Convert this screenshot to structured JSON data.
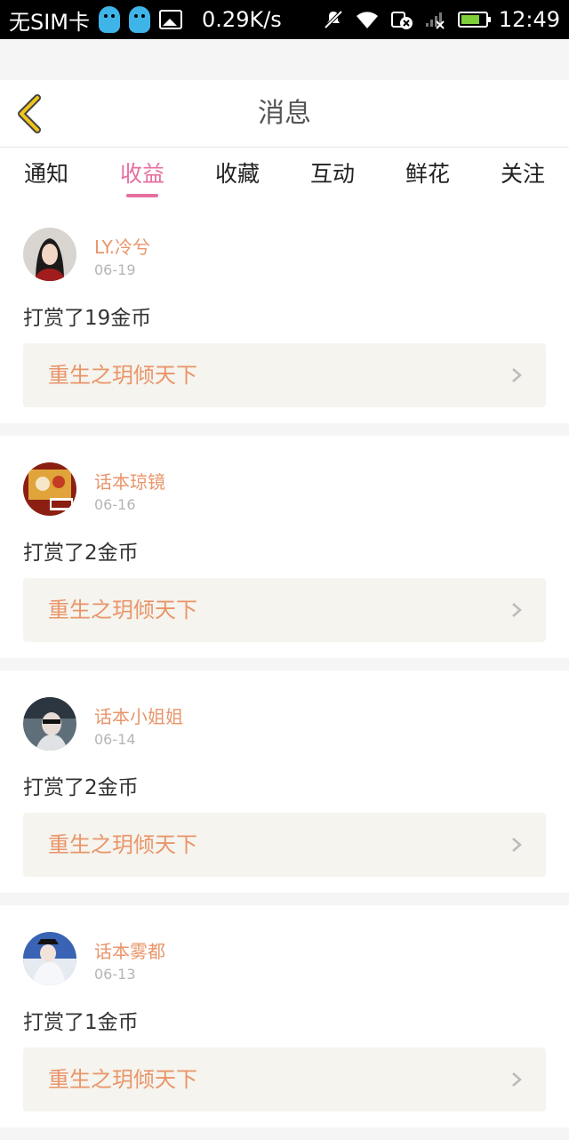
{
  "status_bar": {
    "carrier": "无SIM卡",
    "speed": "0.29K/s",
    "time": "12:49",
    "icons": [
      "qq-icon",
      "qq-icon",
      "gallery-icon",
      "mute-icon",
      "wifi-icon",
      "sim-icon",
      "signal-icon",
      "battery-icon"
    ]
  },
  "header": {
    "title": "消息",
    "back_icon": "back-chevron-icon"
  },
  "tabs": [
    {
      "label": "通知",
      "active": false
    },
    {
      "label": "收益",
      "active": true
    },
    {
      "label": "收藏",
      "active": false
    },
    {
      "label": "互动",
      "active": false
    },
    {
      "label": "鲜花",
      "active": false
    },
    {
      "label": "关注",
      "active": false
    }
  ],
  "messages": [
    {
      "user": "LY.冷兮",
      "date": "06-19",
      "action": "打赏了19金币",
      "book": "重生之玥倾天下"
    },
    {
      "user": "话本琼镜",
      "date": "06-16",
      "action": "打赏了2金币",
      "book": "重生之玥倾天下"
    },
    {
      "user": "话本小姐姐",
      "date": "06-14",
      "action": "打赏了2金币",
      "book": "重生之玥倾天下"
    },
    {
      "user": "话本雾都",
      "date": "06-13",
      "action": "打赏了1金币",
      "book": "重生之玥倾天下"
    }
  ],
  "colors": {
    "accent_pink": "#e66fa0",
    "name_orange": "#e9956a",
    "back_yellow": "#f0c419",
    "battery_green": "#7fcf3a"
  }
}
